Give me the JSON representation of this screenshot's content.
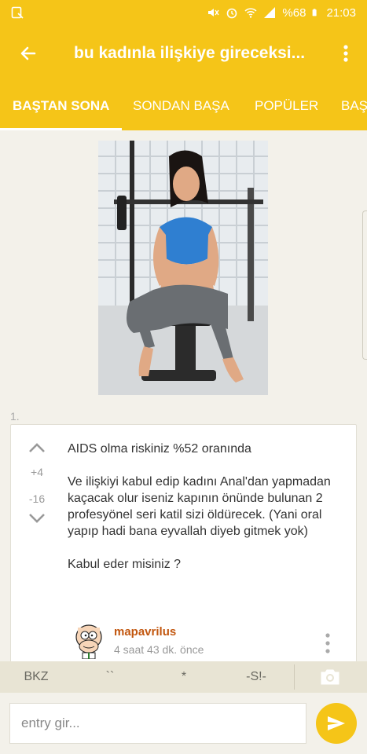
{
  "status_bar": {
    "battery": "%68",
    "time": "21:03",
    "icons": [
      "screenshot-icon",
      "mute-icon",
      "alarm-icon",
      "wifi-icon",
      "signal-icon",
      "battery-icon"
    ]
  },
  "app_bar": {
    "title": "bu kadınla ilişkiye gireceksi...",
    "back_icon": "back-arrow-icon",
    "more_icon": "more-vert-icon"
  },
  "tabs": [
    {
      "label": "BAŞTAN SONA",
      "active": true
    },
    {
      "label": "SONDAN BAŞA",
      "active": false
    },
    {
      "label": "POPÜLER",
      "active": false
    },
    {
      "label": "BAŞ",
      "active": false
    }
  ],
  "entry": {
    "number": "1.",
    "upvotes": "+4",
    "downvotes": "-16",
    "paragraphs": [
      "AIDS olma riskiniz %52 oranında",
      "Ve ilişkiyi kabul edip kadını Anal'dan yapmadan kaçacak olur iseniz kapının önünde bulunan 2 profesyönel seri katil sizi öldürecek. (Yani oral yapıp hadi bana eyvallah diyeb gitmek yok)",
      "Kabul eder misiniz ?"
    ],
    "author": "mapavrilus",
    "time": "4 saat 43 dk. önce"
  },
  "keyboard_bar": {
    "keys": [
      "BKZ",
      "``",
      "*",
      "-S!-"
    ],
    "camera_icon": "camera-icon"
  },
  "input": {
    "placeholder": "entry gir..."
  },
  "colors": {
    "accent": "#f5c518",
    "author": "#c2570f"
  }
}
